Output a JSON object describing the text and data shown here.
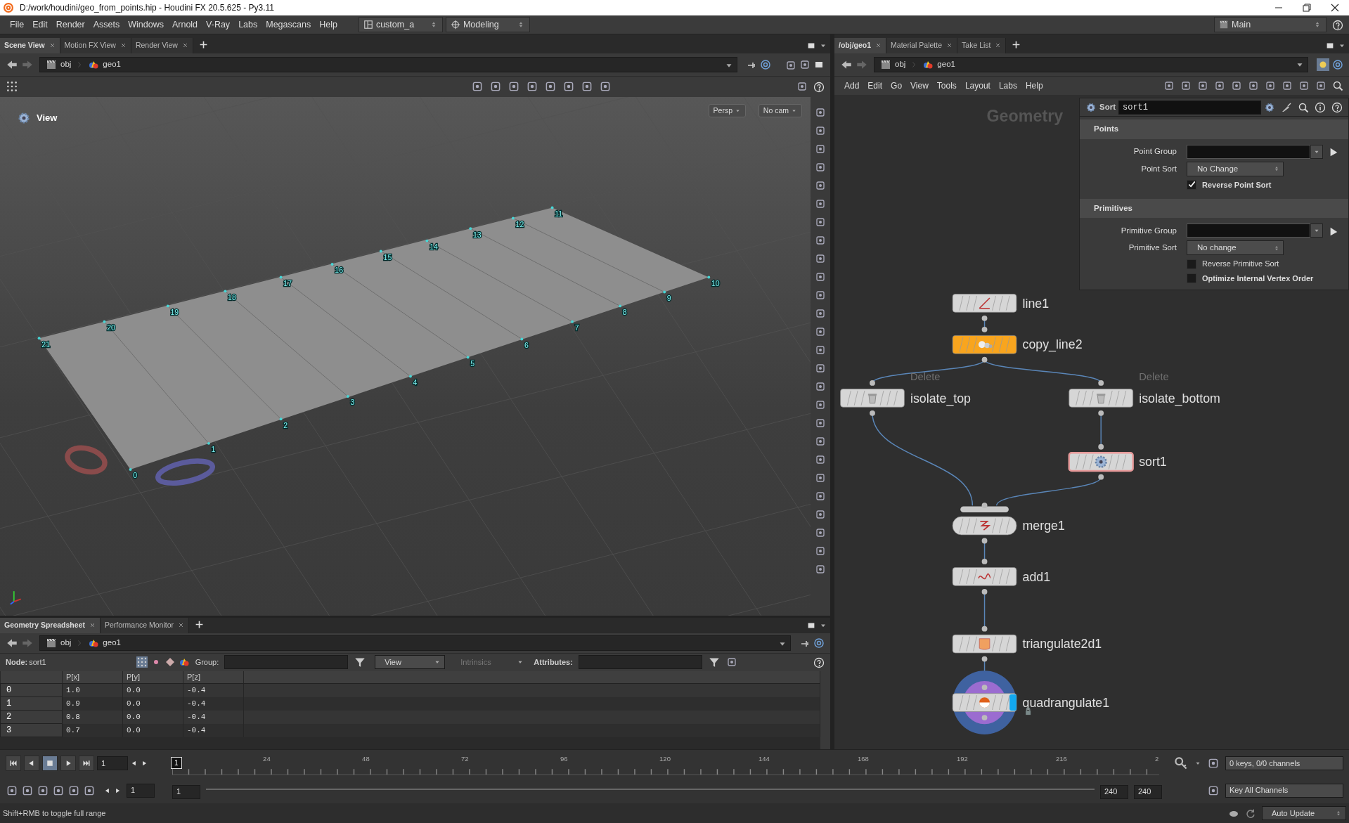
{
  "window": {
    "title": "D:/work/houdini/geo_from_points.hip - Houdini FX 20.5.625 - Py3.11"
  },
  "menu_bar": {
    "items": [
      "File",
      "Edit",
      "Render",
      "Assets",
      "Windows",
      "Arnold",
      "V-Ray",
      "Labs",
      "Megascans",
      "Help"
    ],
    "desktop": "custom_a",
    "shelf_set": "Modeling",
    "context": "Main"
  },
  "scene_pane": {
    "tabs": [
      {
        "label": "Scene View",
        "selected": true
      },
      {
        "label": "Motion FX View",
        "selected": false
      },
      {
        "label": "Render View",
        "selected": false
      }
    ],
    "path": [
      "obj",
      "geo1"
    ],
    "viewport": {
      "title": "View",
      "camera": "Persp",
      "camera_view": "No cam",
      "point_labels": [
        "0",
        "1",
        "2",
        "3",
        "4",
        "5",
        "6",
        "7",
        "8",
        "9",
        "10",
        "11",
        "12",
        "13",
        "14",
        "15",
        "16",
        "17",
        "18",
        "19",
        "20",
        "21"
      ]
    }
  },
  "spreadsheet_pane": {
    "tabs": [
      {
        "label": "Geometry Spreadsheet",
        "selected": true
      },
      {
        "label": "Performance Monitor",
        "selected": false
      }
    ],
    "path": [
      "obj",
      "geo1"
    ],
    "node_label": "Node:",
    "node": "sort1",
    "group_label": "Group:",
    "view_menu": "View",
    "intrinsics_menu": {
      "label": "Intrinsics",
      "disabled": true
    },
    "attributes_label": "Attributes:",
    "columns": [
      "P[x]",
      "P[y]",
      "P[z]"
    ],
    "rows": [
      {
        "index": "0",
        "values": [
          "1.0",
          "0.0",
          "-0.4"
        ]
      },
      {
        "index": "1",
        "values": [
          "0.9",
          "0.0",
          "-0.4"
        ]
      },
      {
        "index": "2",
        "values": [
          "0.8",
          "0.0",
          "-0.4"
        ]
      },
      {
        "index": "3",
        "values": [
          "0.7",
          "0.0",
          "-0.4"
        ]
      }
    ]
  },
  "network_pane": {
    "tabs": [
      {
        "label": "/obj/geo1",
        "selected": true
      },
      {
        "label": "Material Palette",
        "selected": false
      },
      {
        "label": "Take List",
        "selected": false
      }
    ],
    "path": [
      "obj",
      "geo1"
    ],
    "menu": [
      "Add",
      "Edit",
      "Go",
      "View",
      "Tools",
      "Layout",
      "Labs",
      "Help"
    ],
    "context_label": "Geometry",
    "nodes": [
      {
        "name": "line1",
        "kind": "box",
        "color": "#d6d6d6",
        "current": false,
        "display": false,
        "locked": false
      },
      {
        "name": "copy_line2",
        "kind": "box",
        "color": "#f9a51e",
        "current": false,
        "display": false,
        "locked": false
      },
      {
        "name": "isolate_top",
        "type_label": "Delete",
        "kind": "box",
        "color": "#d6d6d6",
        "current": false,
        "display": false,
        "locked": false
      },
      {
        "name": "isolate_bottom",
        "type_label": "Delete",
        "kind": "box",
        "color": "#d6d6d6",
        "current": false,
        "display": false,
        "locked": false
      },
      {
        "name": "sort1",
        "kind": "box",
        "color": "#d6d6d6",
        "current": true,
        "display": false,
        "locked": false
      },
      {
        "name": "merge1",
        "kind": "merge",
        "color": "#d6d6d6",
        "current": false,
        "display": false,
        "locked": false
      },
      {
        "name": "add1",
        "kind": "box",
        "color": "#d6d6d6",
        "current": false,
        "display": false,
        "locked": false
      },
      {
        "name": "triangulate2d1",
        "kind": "box",
        "color": "#d6d6d6",
        "current": false,
        "display": false,
        "locked": false
      },
      {
        "name": "quadrangulate1",
        "kind": "box",
        "color": "#d6d6d6",
        "current": false,
        "display": true,
        "locked": true
      }
    ]
  },
  "parameters": {
    "type": "Sort",
    "name": "sort1",
    "sections": [
      {
        "title": "Points",
        "rows": [
          {
            "kind": "group",
            "label": "Point Group"
          },
          {
            "kind": "menu",
            "label": "Point Sort",
            "value": "No Change"
          },
          {
            "kind": "toggle",
            "label": "Reverse Point Sort",
            "checked": true,
            "non_default": true
          }
        ]
      },
      {
        "title": "Primitives",
        "rows": [
          {
            "kind": "group",
            "label": "Primitive Group"
          },
          {
            "kind": "menu",
            "label": "Primitive Sort",
            "value": "No change"
          },
          {
            "kind": "toggle",
            "label": "Reverse Primitive Sort",
            "checked": false,
            "non_default": false
          },
          {
            "kind": "toggle",
            "label": "Optimize Internal Vertex Order",
            "checked": false,
            "non_default": true
          }
        ]
      }
    ]
  },
  "timeline": {
    "frame": "1",
    "current_frame": "1",
    "ticks": [
      "24",
      "48",
      "72",
      "96",
      "120",
      "144",
      "168",
      "192",
      "216",
      "2"
    ],
    "start": "1",
    "range_start": "1",
    "range_end": "240",
    "end": "240",
    "keys_status": "0 keys, 0/0 channels",
    "key_button": "Key All Channels"
  },
  "status_bar": {
    "message": "Shift+RMB to toggle full range",
    "update_mode": "Auto Update"
  }
}
